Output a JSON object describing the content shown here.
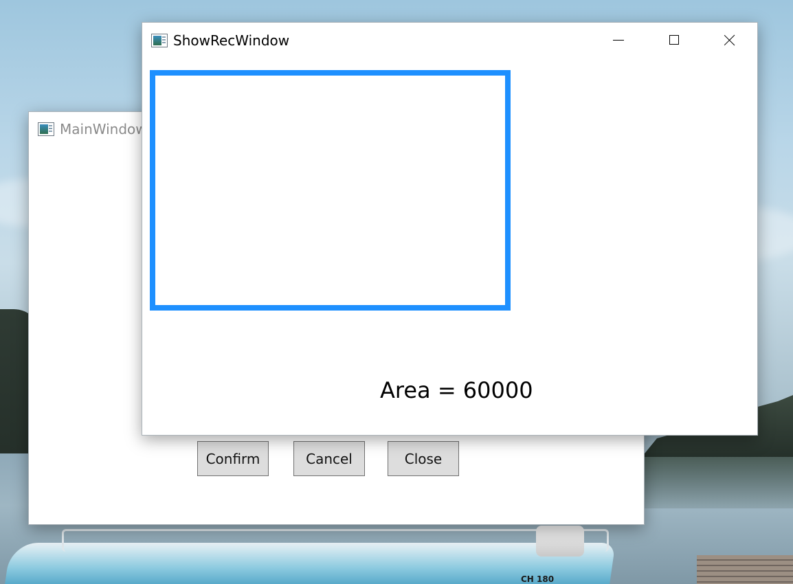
{
  "main_window": {
    "title": "MainWindow",
    "buttons": {
      "confirm": "Confirm",
      "cancel": "Cancel",
      "close": "Close"
    }
  },
  "rec_window": {
    "title": "ShowRecWindow",
    "area_text": "Area = 60000",
    "rectangle": {
      "stroke_color": "#1E90FF",
      "fill_color": "#FFFFFF"
    },
    "caption_buttons": [
      "minimize-icon",
      "maximize-icon",
      "close-icon"
    ]
  },
  "wallpaper": {
    "boat_registration": "CH 180"
  }
}
